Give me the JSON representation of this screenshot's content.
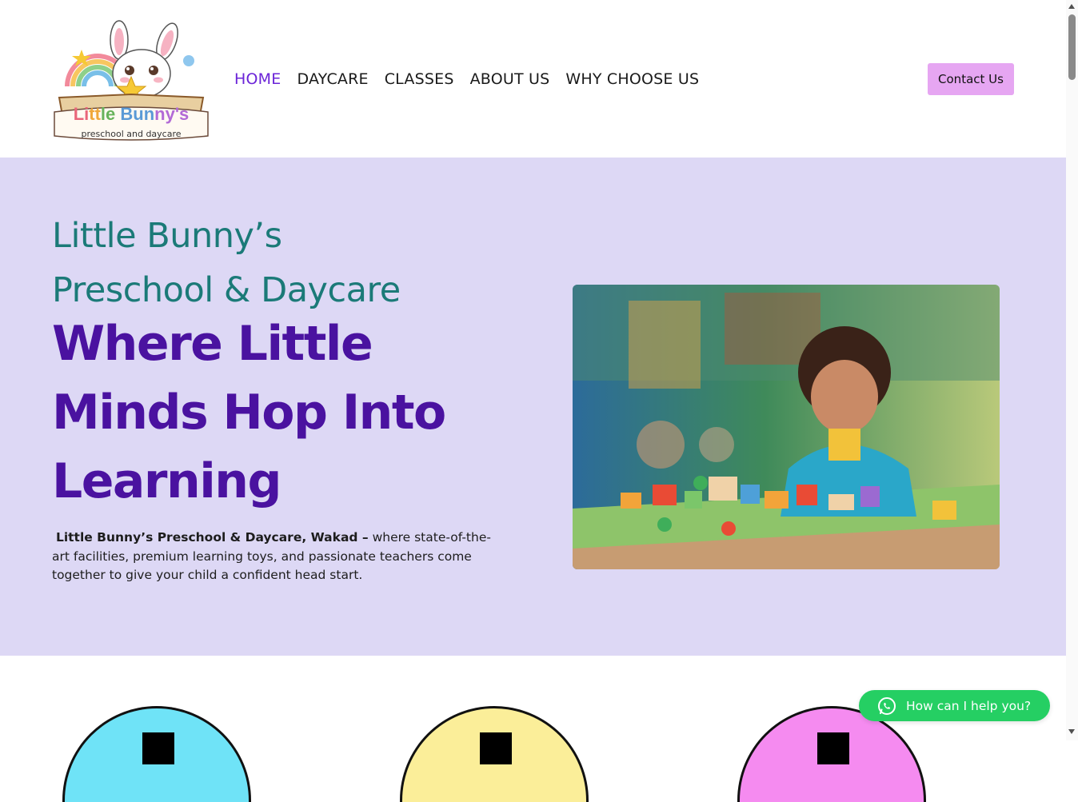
{
  "header": {
    "logo": {
      "title": "Little Bunny's",
      "subtitle": "preschool and daycare"
    },
    "nav": [
      {
        "label": "HOME",
        "active": true
      },
      {
        "label": "DAYCARE",
        "active": false
      },
      {
        "label": "CLASSES",
        "active": false
      },
      {
        "label": "ABOUT US",
        "active": false
      },
      {
        "label": "WHY CHOOSE US",
        "active": false
      }
    ],
    "contact_label": "Contact Us"
  },
  "hero": {
    "subtitle_line1": "Little Bunny’s",
    "subtitle_line2": "Preschool & Daycare",
    "title_line1": "Where Little",
    "title_line2": "Minds Hop Into",
    "title_line3": "Learning",
    "description_bold": "Little Bunny’s Preschool & Daycare, Wakad –",
    "description_rest": " where state-of-the-art facilities, premium learning toys, and passionate teachers come together to give your child a confident head start."
  },
  "whatsapp": {
    "label": "How can I help you?"
  },
  "colors": {
    "accent_purple": "#6b24d8",
    "title_purple": "#4a12a0",
    "teal": "#1b7a78",
    "hero_bg": "#ddd8f5",
    "contact_bg": "#e6a6f2",
    "whatsapp_green": "#25cf63"
  },
  "icons": [
    "bunny-logo-icon",
    "whatsapp-icon"
  ]
}
